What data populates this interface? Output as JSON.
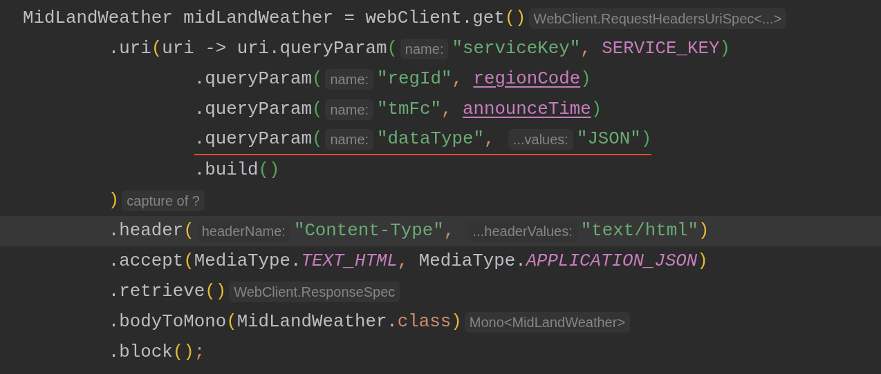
{
  "editor": {
    "lines": [
      {
        "current": false,
        "warning": false,
        "tokens": [
          {
            "kind": "plain",
            "text": "MidLandWeather midLandWeather = webClient.get"
          },
          {
            "kind": "paren1",
            "text": "()"
          },
          {
            "kind": "hint",
            "text": "WebClient.RequestHeadersUriSpec<...>"
          }
        ]
      },
      {
        "current": false,
        "warning": false,
        "tokens": [
          {
            "kind": "plain",
            "text": "        .uri"
          },
          {
            "kind": "paren1",
            "text": "("
          },
          {
            "kind": "plain",
            "text": "uri -> uri.queryParam"
          },
          {
            "kind": "paren2",
            "text": "("
          },
          {
            "kind": "hint",
            "text": "name:"
          },
          {
            "kind": "string",
            "text": "\"serviceKey\""
          },
          {
            "kind": "keyword",
            "text": ", "
          },
          {
            "kind": "constant",
            "text": "SERVICE_KEY"
          },
          {
            "kind": "paren2",
            "text": ")"
          }
        ]
      },
      {
        "current": false,
        "warning": false,
        "tokens": [
          {
            "kind": "plain",
            "text": "                .queryParam"
          },
          {
            "kind": "paren2",
            "text": "("
          },
          {
            "kind": "hint",
            "text": "name:"
          },
          {
            "kind": "string",
            "text": "\"regId\""
          },
          {
            "kind": "keyword",
            "text": ", "
          },
          {
            "kind": "field",
            "text": "regionCode"
          },
          {
            "kind": "paren2",
            "text": ")"
          }
        ]
      },
      {
        "current": false,
        "warning": false,
        "tokens": [
          {
            "kind": "plain",
            "text": "                .queryParam"
          },
          {
            "kind": "paren2",
            "text": "("
          },
          {
            "kind": "hint",
            "text": "name:"
          },
          {
            "kind": "string",
            "text": "\"tmFc\""
          },
          {
            "kind": "keyword",
            "text": ", "
          },
          {
            "kind": "field",
            "text": "announceTime"
          },
          {
            "kind": "paren2",
            "text": ")"
          }
        ]
      },
      {
        "current": false,
        "warning": true,
        "tokens": [
          {
            "kind": "plain",
            "text": "                .queryParam"
          },
          {
            "kind": "paren2",
            "text": "("
          },
          {
            "kind": "hint",
            "text": "name:"
          },
          {
            "kind": "string",
            "text": "\"dataType\""
          },
          {
            "kind": "keyword",
            "text": ", "
          },
          {
            "kind": "hint",
            "text": "...values:"
          },
          {
            "kind": "string",
            "text": "\"JSON\""
          },
          {
            "kind": "paren2",
            "text": ")"
          }
        ]
      },
      {
        "current": false,
        "warning": false,
        "tokens": [
          {
            "kind": "plain",
            "text": "                .build"
          },
          {
            "kind": "paren2",
            "text": "()"
          }
        ]
      },
      {
        "current": false,
        "warning": false,
        "tokens": [
          {
            "kind": "paren1",
            "text": "        )"
          },
          {
            "kind": "hint",
            "text": "capture of ?"
          }
        ]
      },
      {
        "current": true,
        "warning": false,
        "tokens": [
          {
            "kind": "plain",
            "text": "        .header"
          },
          {
            "kind": "paren1",
            "text": "("
          },
          {
            "kind": "hint",
            "text": "headerName:"
          },
          {
            "kind": "string",
            "text": "\"Content-Type\""
          },
          {
            "kind": "keyword",
            "text": ", "
          },
          {
            "kind": "hint",
            "text": "...headerValues:"
          },
          {
            "kind": "string",
            "text": "\"text/html\""
          },
          {
            "kind": "paren1",
            "text": ")"
          }
        ]
      },
      {
        "current": false,
        "warning": false,
        "tokens": [
          {
            "kind": "plain",
            "text": "        .accept"
          },
          {
            "kind": "paren1",
            "text": "("
          },
          {
            "kind": "plain",
            "text": "MediaType."
          },
          {
            "kind": "static",
            "text": "TEXT_HTML"
          },
          {
            "kind": "keyword",
            "text": ","
          },
          {
            "kind": "plain",
            "text": " MediaType."
          },
          {
            "kind": "static",
            "text": "APPLICATION_JSON"
          },
          {
            "kind": "paren1",
            "text": ")"
          }
        ]
      },
      {
        "current": false,
        "warning": false,
        "tokens": [
          {
            "kind": "plain",
            "text": "        .retrieve"
          },
          {
            "kind": "paren1",
            "text": "()"
          },
          {
            "kind": "hint",
            "text": "WebClient.ResponseSpec"
          }
        ]
      },
      {
        "current": false,
        "warning": false,
        "tokens": [
          {
            "kind": "plain",
            "text": "        .bodyToMono"
          },
          {
            "kind": "paren1",
            "text": "("
          },
          {
            "kind": "plain",
            "text": "MidLandWeather."
          },
          {
            "kind": "keyword",
            "text": "class"
          },
          {
            "kind": "paren1",
            "text": ")"
          },
          {
            "kind": "hint",
            "text": "Mono<MidLandWeather>"
          }
        ]
      },
      {
        "current": false,
        "warning": false,
        "tokens": [
          {
            "kind": "plain",
            "text": "        .block"
          },
          {
            "kind": "paren1",
            "text": "()"
          },
          {
            "kind": "keyword",
            "text": ";"
          }
        ]
      }
    ]
  }
}
